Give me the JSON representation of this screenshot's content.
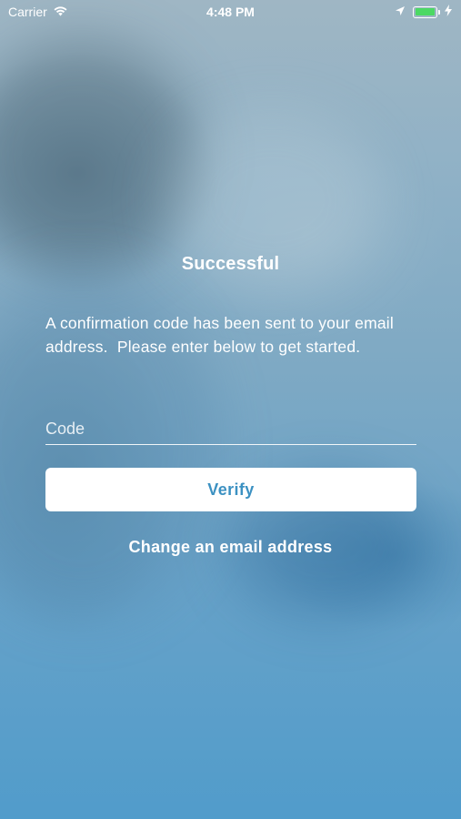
{
  "status_bar": {
    "carrier": "Carrier",
    "time": "4:48 PM",
    "battery_level": 1.0,
    "battery_color": "#4cd964",
    "icons": [
      "wifi-icon",
      "location-arrow-icon",
      "battery-icon",
      "charging-bolt-icon"
    ]
  },
  "screen": {
    "title": "Successful",
    "message": "A confirmation code has been sent to your email address.  Please enter below to get started.",
    "code_field": {
      "value": "",
      "placeholder": "Code"
    },
    "verify_label": "Verify",
    "change_email_label": "Change an email address"
  },
  "colors": {
    "accent": "#3c91c2",
    "text": "#ffffff",
    "button_background": "#ffffff"
  }
}
